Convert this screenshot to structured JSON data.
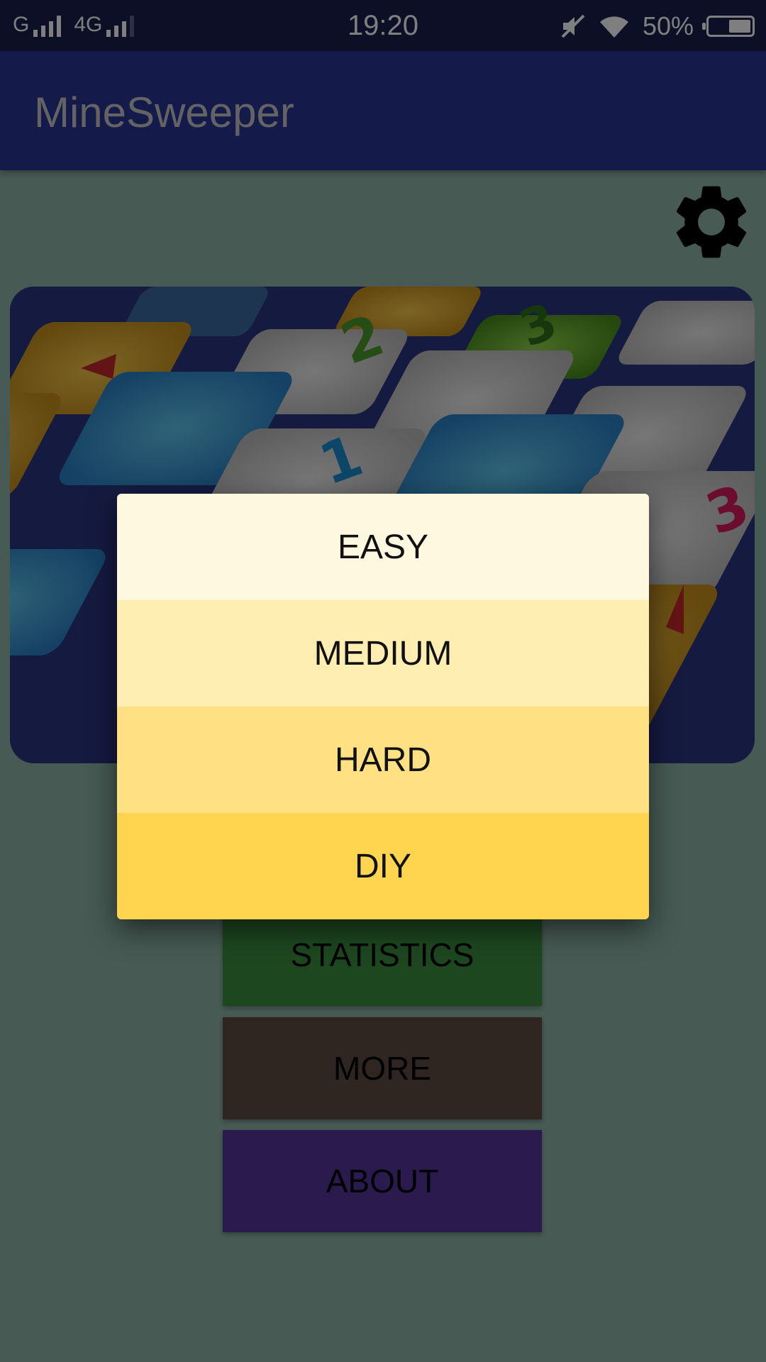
{
  "status_bar": {
    "carrier1": "G",
    "carrier2": "4G",
    "time": "19:20",
    "battery": "50%",
    "icons": [
      "signal-icon",
      "mute-icon",
      "wifi-icon",
      "battery-icon"
    ]
  },
  "app_bar": {
    "title": "MineSweeper"
  },
  "settings": {
    "icon": "gear-icon"
  },
  "hero": {
    "tiles": [
      "2",
      "3",
      "1",
      "3"
    ]
  },
  "menu": {
    "statistics": "STATISTICS",
    "more": "MORE",
    "about": "ABOUT"
  },
  "dialog": {
    "options": [
      "EASY",
      "MEDIUM",
      "HARD",
      "DIY"
    ]
  },
  "colors": {
    "status_bar": "#1b1f4d",
    "app_bar": "#283593",
    "background": "#8fb5a8",
    "statistics": "#3a8f3f",
    "more": "#5e4a42",
    "about": "#55359b",
    "easy": "#fff8e1",
    "medium": "#ffeeb2",
    "hard": "#ffe083",
    "diy": "#ffd54f"
  }
}
